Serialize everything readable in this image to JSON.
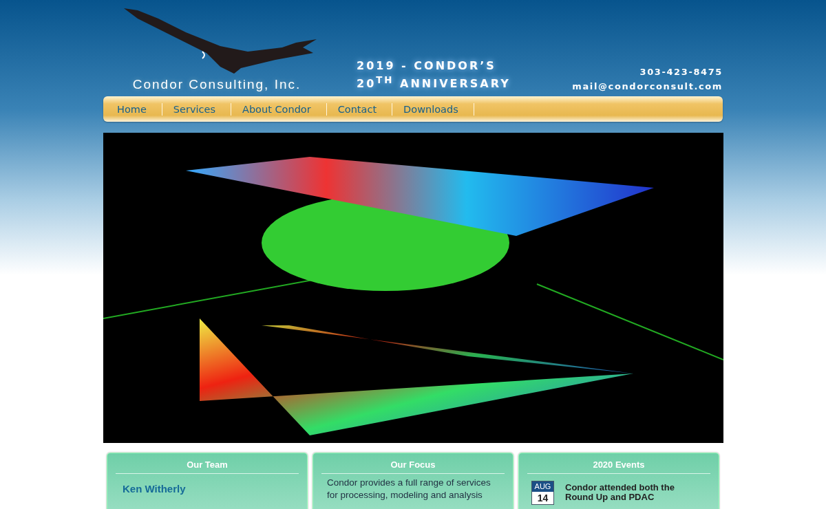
{
  "header": {
    "company": "Condor Consulting, Inc.",
    "anniversary_line1": "2019 - CONDOR’S",
    "anniversary_line2": "20$^{TH}$ ANNIVERSARY",
    "phone": "303-423-8475",
    "email": "mail@condorconsult.com"
  },
  "nav": [
    {
      "label": "Home"
    },
    {
      "label": "Services"
    },
    {
      "label": "About Condor"
    },
    {
      "label": "Contact"
    },
    {
      "label": "Downloads"
    }
  ],
  "cards": [
    {
      "kind": "team",
      "title": "Our Team",
      "name": "Ken Witherly"
    },
    {
      "kind": "text",
      "title": "Our Focus",
      "text": "Condor provides a full range of services for processing, modeling and analysis"
    },
    {
      "kind": "events",
      "title": "2020 Events",
      "events": [
        {
          "month": "AUG",
          "day": "14",
          "text": "Condor attended both the Round Up and PDAC"
        }
      ]
    }
  ]
}
